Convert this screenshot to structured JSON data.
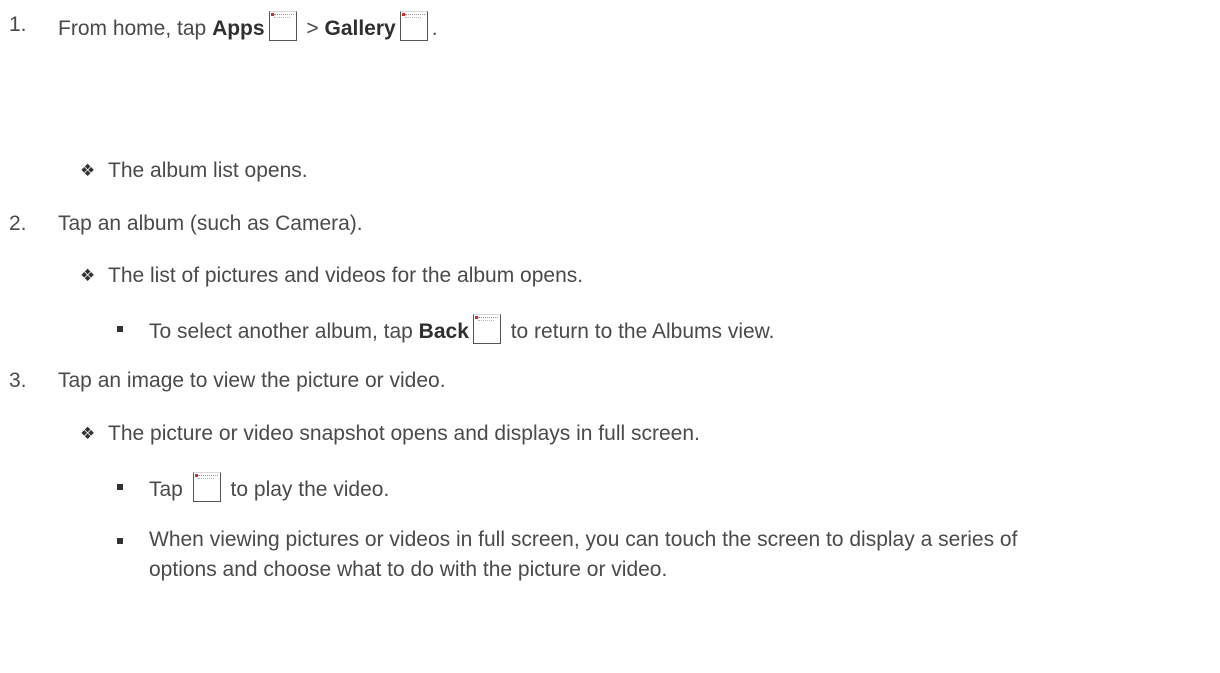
{
  "step1": {
    "number": "1.",
    "prefix": "From home, tap ",
    "apps": "Apps",
    "sep": " > ",
    "gallery": "Gallery",
    "suffix": "."
  },
  "result1": {
    "text": "The album list opens."
  },
  "step2": {
    "number": "2.",
    "text": "Tap an album (such as Camera)."
  },
  "result2": {
    "text": "The list of pictures and videos for the album opens."
  },
  "note2": {
    "prefix": "To select another album, tap ",
    "back": "Back",
    "suffix": " to return to the Albums view."
  },
  "step3": {
    "number": "3.",
    "text": "Tap an image to view the picture or video."
  },
  "result3": {
    "text": "The picture or video snapshot opens and displays in full screen."
  },
  "note3a": {
    "prefix": "Tap ",
    "suffix": " to play the video."
  },
  "note3b": {
    "line1": "When viewing pictures or videos in full screen, you can touch the screen to display a series of",
    "line2": "options and choose what to do with the picture or video."
  },
  "icons": {
    "apps": "apps-icon",
    "gallery": "gallery-icon",
    "back": "back-icon",
    "play": "play-icon",
    "diamond_bullet": "diamond-bullet-icon",
    "square_bullet": "square-bullet-icon"
  }
}
